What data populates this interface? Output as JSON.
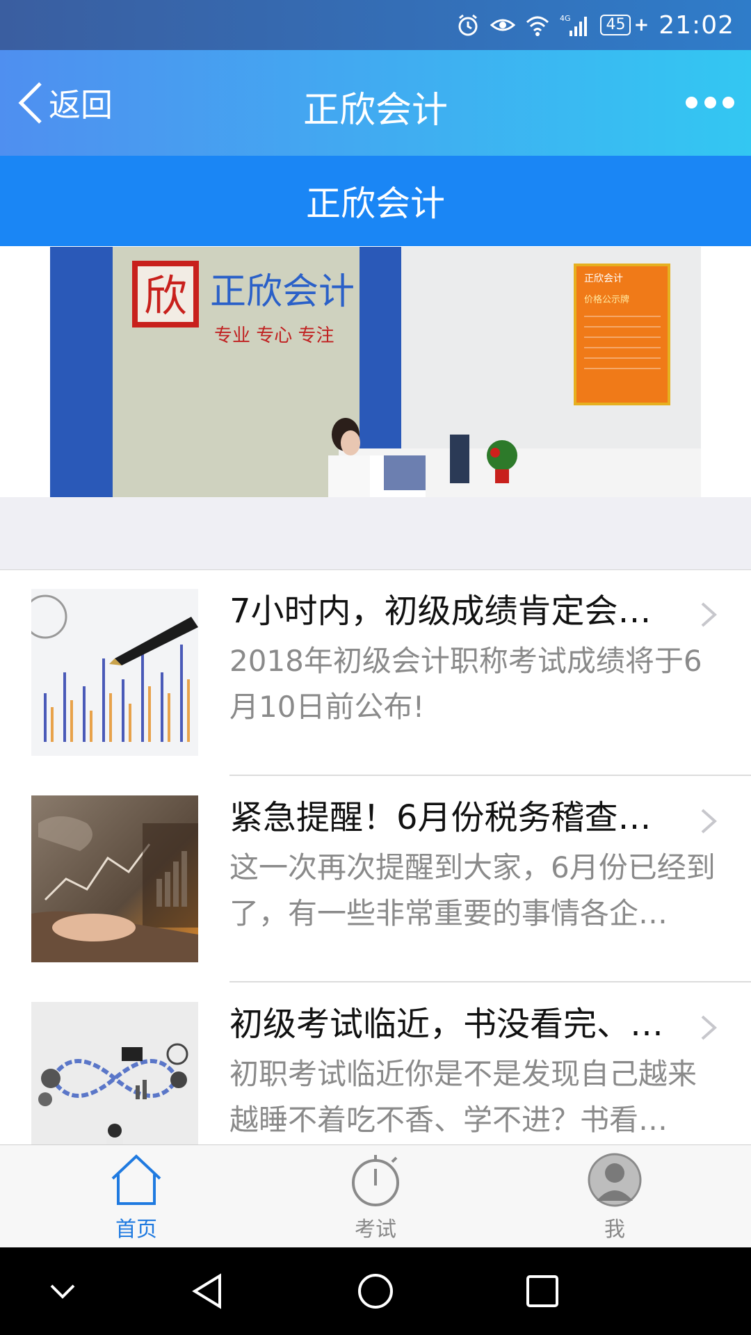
{
  "status_bar": {
    "time": "21:02",
    "battery": "45",
    "network": "4G",
    "icons": [
      "alarm-icon",
      "eye-icon",
      "wifi-icon",
      "signal-icon",
      "battery-icon"
    ]
  },
  "header": {
    "back_label": "返回",
    "title": "正欣会计",
    "more_icon": "more-icon"
  },
  "subheader": {
    "title": "正欣会计"
  },
  "banner": {
    "logo_char": "欣",
    "sign_text": "正欣会计",
    "slogan": "专业  专心  专注",
    "board_title": "正欣会计",
    "board_subtitle": "价格公示牌"
  },
  "articles": [
    {
      "title": "7小时内，初级成绩肯定会…",
      "desc": "2018年初级会计职称考试成绩将于6月10日前公布!"
    },
    {
      "title": "紧急提醒！6月份税务稽查…",
      "desc": "这一次再次提醒到大家，6月份已经到了，有一些非常重要的事情各企…"
    },
    {
      "title": "初级考试临近，书没看完、…",
      "desc": "初职考试临近你是不是发现自己越来越睡不着吃不香、学不进？书看…"
    }
  ],
  "tabbar": {
    "tabs": [
      {
        "label": "首页",
        "icon": "home-icon",
        "active": true
      },
      {
        "label": "考试",
        "icon": "stopwatch-icon",
        "active": false
      },
      {
        "label": "我",
        "icon": "avatar-icon",
        "active": false
      }
    ]
  },
  "colors": {
    "header_gradient_start": "#4f8ff0",
    "header_gradient_end": "#33c7f2",
    "subheader": "#1a86f5",
    "active_tab": "#1f7ae0"
  }
}
